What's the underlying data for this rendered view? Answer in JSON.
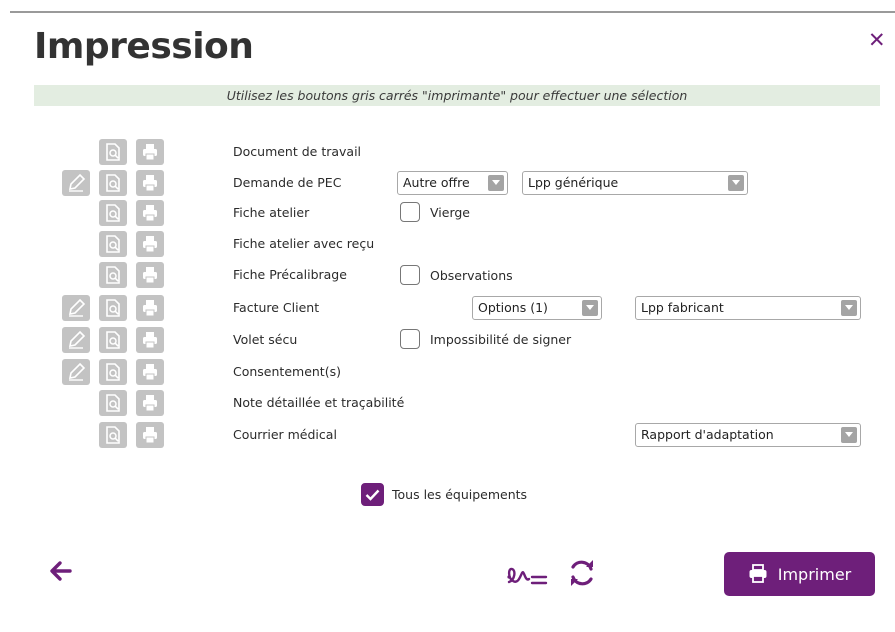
{
  "dialog": {
    "title": "Impression",
    "hint": "Utilisez les boutons gris carrés \"imprimante\" pour effectuer une sélection"
  },
  "rows": [
    {
      "label": "Document de travail",
      "has_sign": false
    },
    {
      "label": "Demande de PEC",
      "has_sign": true
    },
    {
      "label": "Fiche atelier",
      "has_sign": false
    },
    {
      "label": "Fiche atelier avec reçu",
      "has_sign": false
    },
    {
      "label": "Fiche Précalibrage",
      "has_sign": false
    },
    {
      "label": "Facture Client",
      "has_sign": true
    },
    {
      "label": "Volet sécu",
      "has_sign": true
    },
    {
      "label": "Consentement(s)",
      "has_sign": true
    },
    {
      "label": "Note détaillée et traçabilité",
      "has_sign": false
    },
    {
      "label": "Courrier médical",
      "has_sign": false
    }
  ],
  "selects": {
    "pec_offer": "Autre offre",
    "pec_lpp": "Lpp générique",
    "facture_options": "Options (1)",
    "facture_lpp": "Lpp fabricant",
    "courrier_report": "Rapport d'adaptation"
  },
  "checkboxes": {
    "vierge": {
      "label": "Vierge",
      "checked": false
    },
    "observations": {
      "label": "Observations",
      "checked": false
    },
    "impossibilite": {
      "label": "Impossibilité de signer",
      "checked": false
    },
    "tous_equipements": {
      "label": "Tous les équipements",
      "checked": true
    }
  },
  "footer": {
    "print_label": "Imprimer"
  },
  "icons": {
    "close": "close-icon",
    "sign": "pencil-icon",
    "preview": "preview-icon",
    "print": "printer-icon",
    "back": "arrow-left-icon",
    "signature": "signature-icon",
    "refresh": "refresh-icon"
  },
  "colors": {
    "accent": "#6e1f7a",
    "hint_bg": "#e3ede1",
    "square_btn": "#c3c3c3"
  }
}
